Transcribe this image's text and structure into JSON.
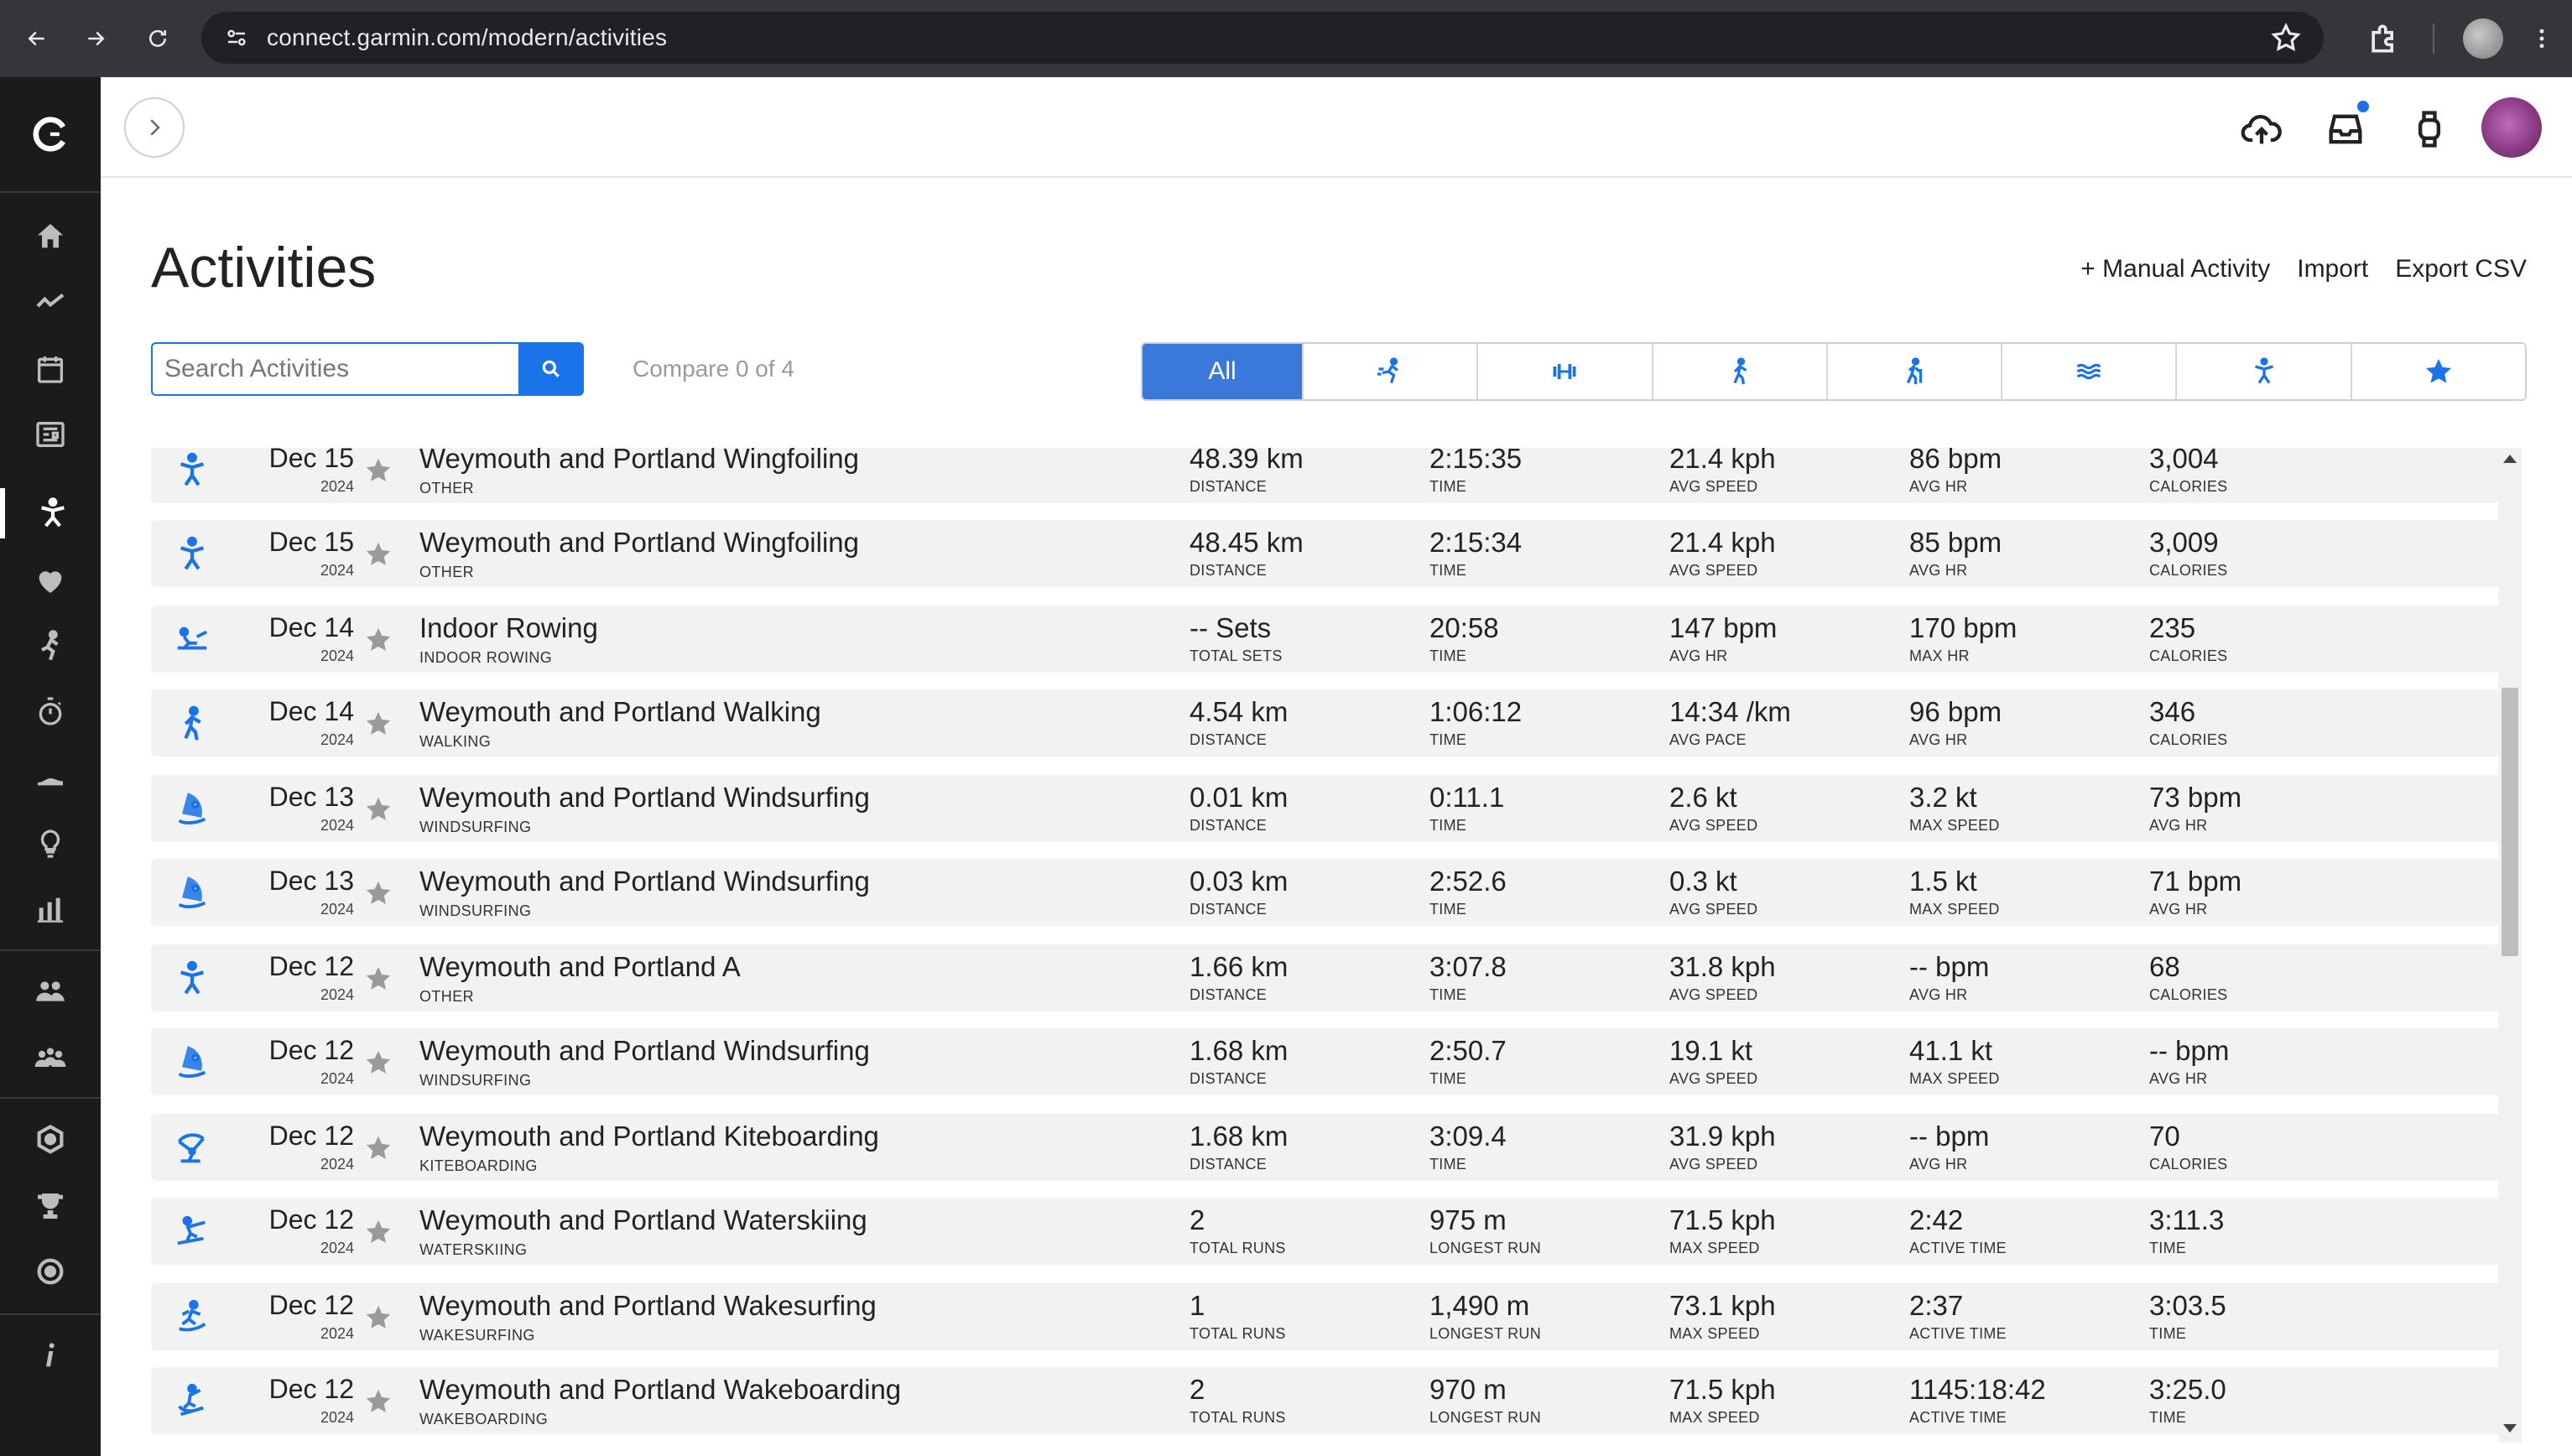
{
  "browser": {
    "url": "connect.garmin.com/modern/activities"
  },
  "page": {
    "title": "Activities",
    "actions": {
      "manual": "+ Manual Activity",
      "import": "Import",
      "export": "Export CSV"
    },
    "search_placeholder": "Search Activities",
    "compare": "Compare 0 of 4",
    "filters": [
      "All",
      "running-icon",
      "strength-icon",
      "walking-icon",
      "hiking-icon",
      "swimming-icon",
      "other-icon",
      "favorites-icon"
    ]
  },
  "sidebar": {
    "items": [
      "home-icon",
      "insights-icon",
      "calendar-icon",
      "news-feed-icon",
      "activities-icon",
      "health-icon",
      "training-icon",
      "timer-icon",
      "gear-icon",
      "tips-icon",
      "reports-icon",
      "connections-icon",
      "groups-icon",
      "badges-icon",
      "challenges-icon",
      "courses-icon",
      "info-icon"
    ]
  },
  "activities": [
    {
      "date": "Dec 15",
      "year": "2024",
      "name": "Weymouth and Portland Wingfoiling",
      "type": "OTHER",
      "icon": "other-icon",
      "stats": [
        [
          "48.39 km",
          "DISTANCE"
        ],
        [
          "2:15:35",
          "TIME"
        ],
        [
          "21.4 kph",
          "AVG SPEED"
        ],
        [
          "86 bpm",
          "AVG HR"
        ],
        [
          "3,004",
          "CALORIES"
        ]
      ]
    },
    {
      "date": "Dec 15",
      "year": "2024",
      "name": "Weymouth and Portland Wingfoiling",
      "type": "OTHER",
      "icon": "other-icon",
      "stats": [
        [
          "48.45 km",
          "DISTANCE"
        ],
        [
          "2:15:34",
          "TIME"
        ],
        [
          "21.4 kph",
          "AVG SPEED"
        ],
        [
          "85 bpm",
          "AVG HR"
        ],
        [
          "3,009",
          "CALORIES"
        ]
      ]
    },
    {
      "date": "Dec 14",
      "year": "2024",
      "name": "Indoor Rowing",
      "type": "INDOOR ROWING",
      "icon": "rowing-icon",
      "stats": [
        [
          "-- Sets",
          "TOTAL SETS"
        ],
        [
          "20:58",
          "TIME"
        ],
        [
          "147 bpm",
          "AVG HR"
        ],
        [
          "170 bpm",
          "MAX HR"
        ],
        [
          "235",
          "CALORIES"
        ]
      ]
    },
    {
      "date": "Dec 14",
      "year": "2024",
      "name": "Weymouth and Portland Walking",
      "type": "WALKING",
      "icon": "walking-icon",
      "stats": [
        [
          "4.54 km",
          "DISTANCE"
        ],
        [
          "1:06:12",
          "TIME"
        ],
        [
          "14:34 /km",
          "AVG PACE"
        ],
        [
          "96 bpm",
          "AVG HR"
        ],
        [
          "346",
          "CALORIES"
        ]
      ]
    },
    {
      "date": "Dec 13",
      "year": "2024",
      "name": "Weymouth and Portland Windsurfing",
      "type": "WINDSURFING",
      "icon": "windsurfing-icon",
      "stats": [
        [
          "0.01 km",
          "DISTANCE"
        ],
        [
          "0:11.1",
          "TIME"
        ],
        [
          "2.6 kt",
          "AVG SPEED"
        ],
        [
          "3.2 kt",
          "MAX SPEED"
        ],
        [
          "73 bpm",
          "AVG HR"
        ]
      ]
    },
    {
      "date": "Dec 13",
      "year": "2024",
      "name": "Weymouth and Portland Windsurfing",
      "type": "WINDSURFING",
      "icon": "windsurfing-icon",
      "stats": [
        [
          "0.03 km",
          "DISTANCE"
        ],
        [
          "2:52.6",
          "TIME"
        ],
        [
          "0.3 kt",
          "AVG SPEED"
        ],
        [
          "1.5 kt",
          "MAX SPEED"
        ],
        [
          "71 bpm",
          "AVG HR"
        ]
      ]
    },
    {
      "date": "Dec 12",
      "year": "2024",
      "name": "Weymouth and Portland A",
      "type": "OTHER",
      "icon": "other-icon",
      "stats": [
        [
          "1.66 km",
          "DISTANCE"
        ],
        [
          "3:07.8",
          "TIME"
        ],
        [
          "31.8 kph",
          "AVG SPEED"
        ],
        [
          "-- bpm",
          "AVG HR"
        ],
        [
          "68",
          "CALORIES"
        ]
      ]
    },
    {
      "date": "Dec 12",
      "year": "2024",
      "name": "Weymouth and Portland Windsurfing",
      "type": "WINDSURFING",
      "icon": "windsurfing-icon",
      "stats": [
        [
          "1.68 km",
          "DISTANCE"
        ],
        [
          "2:50.7",
          "TIME"
        ],
        [
          "19.1 kt",
          "AVG SPEED"
        ],
        [
          "41.1 kt",
          "MAX SPEED"
        ],
        [
          "-- bpm",
          "AVG HR"
        ]
      ]
    },
    {
      "date": "Dec 12",
      "year": "2024",
      "name": "Weymouth and Portland Kiteboarding",
      "type": "KITEBOARDING",
      "icon": "kiteboarding-icon",
      "stats": [
        [
          "1.68 km",
          "DISTANCE"
        ],
        [
          "3:09.4",
          "TIME"
        ],
        [
          "31.9 kph",
          "AVG SPEED"
        ],
        [
          "-- bpm",
          "AVG HR"
        ],
        [
          "70",
          "CALORIES"
        ]
      ]
    },
    {
      "date": "Dec 12",
      "year": "2024",
      "name": "Weymouth and Portland Waterskiing",
      "type": "WATERSKIING",
      "icon": "waterskiing-icon",
      "stats": [
        [
          "2",
          "TOTAL RUNS"
        ],
        [
          "975 m",
          "LONGEST RUN"
        ],
        [
          "71.5 kph",
          "MAX SPEED"
        ],
        [
          "2:42",
          "ACTIVE TIME"
        ],
        [
          "3:11.3",
          "TIME"
        ]
      ]
    },
    {
      "date": "Dec 12",
      "year": "2024",
      "name": "Weymouth and Portland Wakesurfing",
      "type": "WAKESURFING",
      "icon": "wakesurfing-icon",
      "stats": [
        [
          "1",
          "TOTAL RUNS"
        ],
        [
          "1,490 m",
          "LONGEST RUN"
        ],
        [
          "73.1 kph",
          "MAX SPEED"
        ],
        [
          "2:37",
          "ACTIVE TIME"
        ],
        [
          "3:03.5",
          "TIME"
        ]
      ]
    },
    {
      "date": "Dec 12",
      "year": "2024",
      "name": "Weymouth and Portland Wakeboarding",
      "type": "WAKEBOARDING",
      "icon": "wakeboarding-icon",
      "stats": [
        [
          "2",
          "TOTAL RUNS"
        ],
        [
          "970 m",
          "LONGEST RUN"
        ],
        [
          "71.5 kph",
          "MAX SPEED"
        ],
        [
          "1145:18:42",
          "ACTIVE TIME"
        ],
        [
          "3:25.0",
          "TIME"
        ]
      ]
    }
  ]
}
